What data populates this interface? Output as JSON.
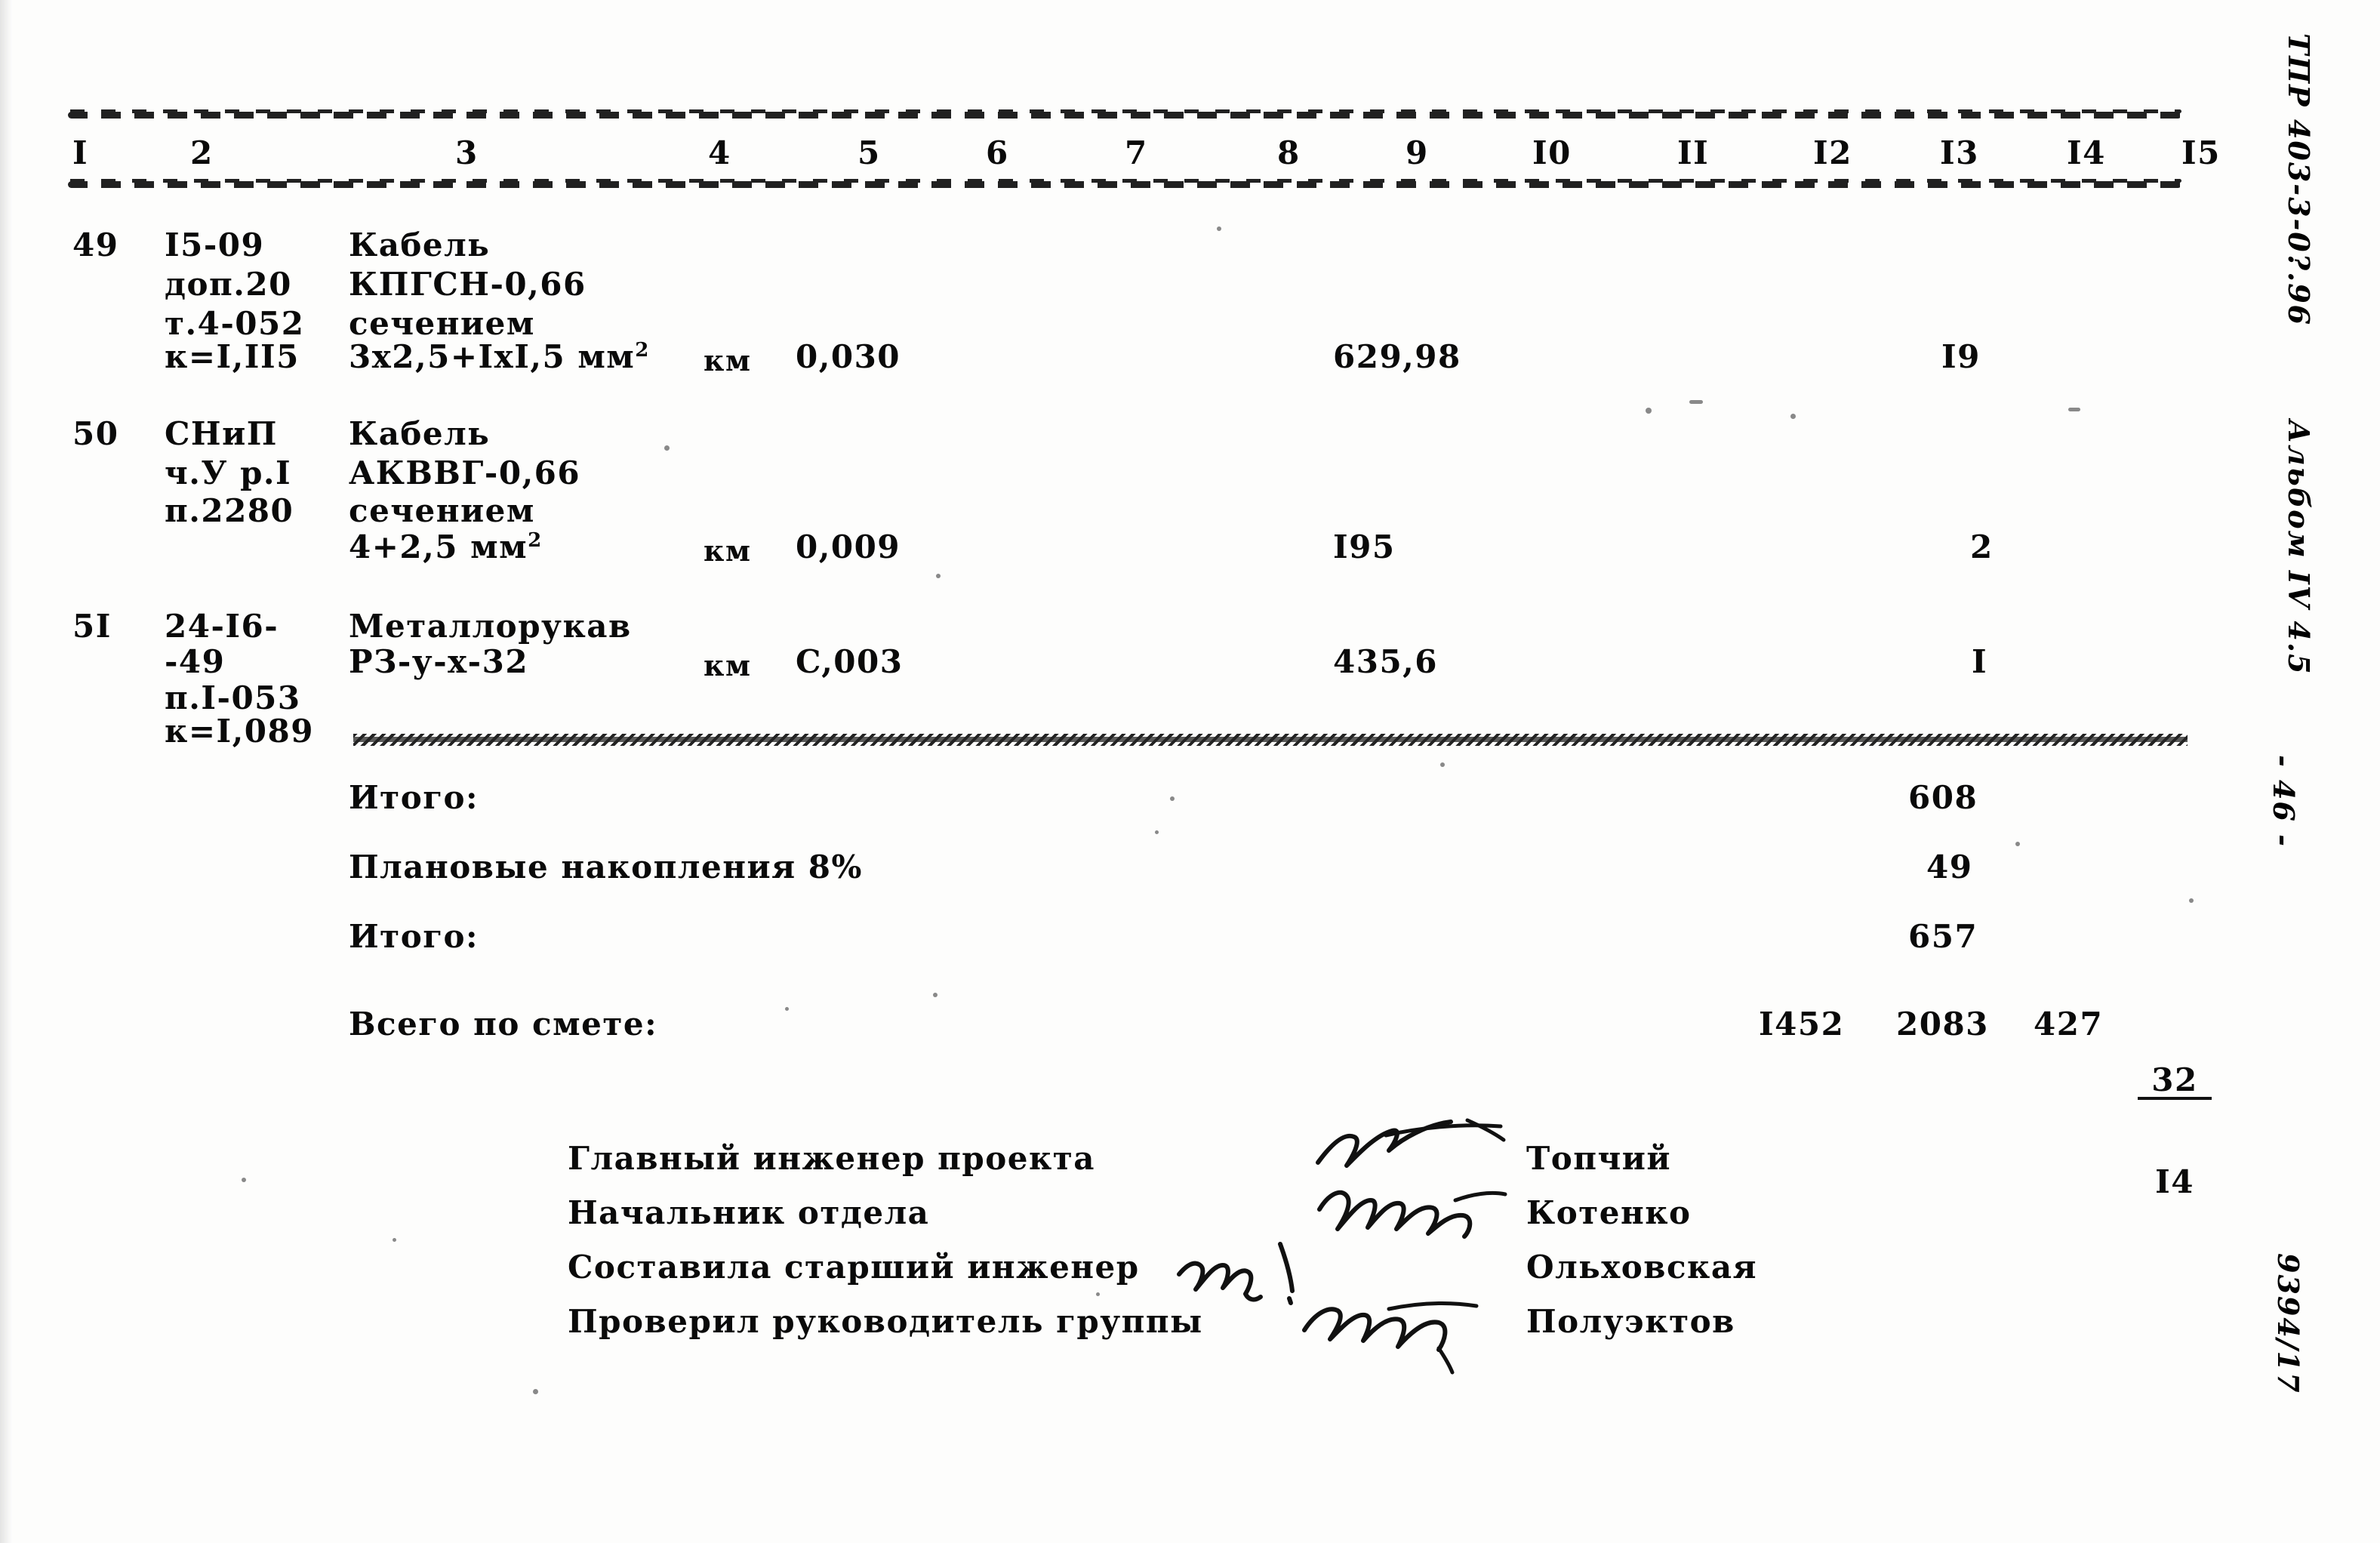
{
  "document": {
    "type": "smeta-table",
    "page_number": "- 46 -",
    "margin_code_top": "ТПР 403-3-0?.96",
    "margin_album": "Альбом IV 4.5",
    "margin_code_bottom": "9394/17"
  },
  "table": {
    "column_headers": [
      "I",
      "2",
      "3",
      "4",
      "5",
      "6",
      "7",
      "8",
      "9",
      "I0",
      "II",
      "I2",
      "I3",
      "I4",
      "I5"
    ],
    "rows": [
      {
        "num": "49",
        "code_lines": [
          "I5-09",
          "доп.20",
          "т.4-052",
          "к=I,II5"
        ],
        "name_lines": [
          "Кабель",
          "КПГСН-0,66",
          "сечением",
          "3х2,5+IхI,5 мм"
        ],
        "name_superscript": "2",
        "unit": "км",
        "qty": "0,030",
        "col8": "629,98",
        "col13": "I9"
      },
      {
        "num": "50",
        "code_lines": [
          "СНиП",
          "ч.У р.I",
          "п.2280",
          ""
        ],
        "name_lines": [
          "Кабель",
          "АКВВГ-0,66",
          "сечением",
          "4+2,5 мм"
        ],
        "name_superscript": "2",
        "unit": "км",
        "qty": "0,009",
        "col8": "I95",
        "col13": "2"
      },
      {
        "num": "5I",
        "code_lines": [
          "24-I6-",
          "-49",
          "п.I-053",
          "к=I,089"
        ],
        "name_lines": [
          "Металлорукав",
          "РЗ-у-х-32"
        ],
        "name_superscript": "",
        "unit": "км",
        "qty": "C,003",
        "col8": "435,6",
        "col13": "I"
      }
    ]
  },
  "totals": [
    {
      "label": "Итого:",
      "value": "608"
    },
    {
      "label": "Плановые накопления 8%",
      "value": "49"
    },
    {
      "label": "Итого:",
      "value": "657"
    }
  ],
  "grand_total": {
    "label": "Всего по смете:",
    "col11": "I452",
    "col13": "2083",
    "col14": "427",
    "col15_numerator": "32",
    "col15_denominator": "I4"
  },
  "signatures": [
    {
      "title": "Главный инженер проекта",
      "name": "Топчий"
    },
    {
      "title": "Начальник отдела",
      "name": "Котенко"
    },
    {
      "title": "Составила старший инженер",
      "name": "Ольховская"
    },
    {
      "title": "Проверил руководитель группы",
      "name": "Полуэктов"
    }
  ]
}
